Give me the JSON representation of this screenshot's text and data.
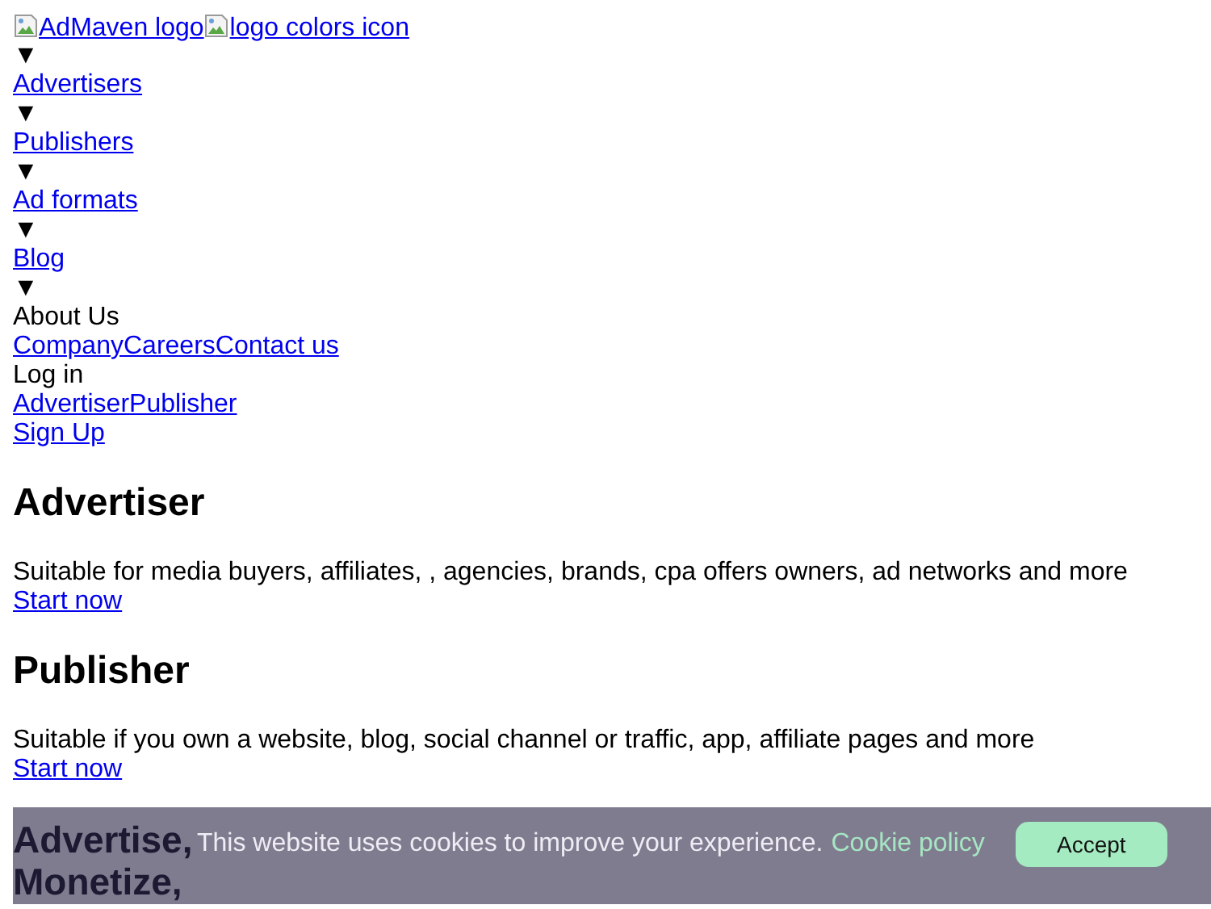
{
  "logos": [
    {
      "alt": "AdMaven logo"
    },
    {
      "alt": "logo colors icon"
    }
  ],
  "nav": [
    {
      "marker": "▼",
      "label": "Advertisers",
      "kind": "link"
    },
    {
      "marker": "▼",
      "label": "Publishers",
      "kind": "link"
    },
    {
      "marker": "▼",
      "label": "Ad formats",
      "kind": "link"
    },
    {
      "marker": "▼",
      "label": "Blog",
      "kind": "link"
    },
    {
      "marker": "▼",
      "label": "About Us",
      "kind": "text"
    }
  ],
  "about_links": [
    "Company",
    "Careers",
    "Contact us"
  ],
  "login": {
    "label": "Log in",
    "links": [
      "Advertiser",
      "Publisher"
    ]
  },
  "signup": "Sign Up",
  "sections": [
    {
      "title": "Advertiser",
      "text": "Suitable for media buyers, affiliates, , agencies, brands, cpa offers owners, ad networks and more",
      "cta": "Start now"
    },
    {
      "title": "Publisher",
      "text": "Suitable if you own a website, blog, social channel or traffic, app, affiliate pages and more",
      "cta": "Start now"
    }
  ],
  "banner": {
    "title_lines": [
      "Advertise,",
      "Monetize,"
    ]
  },
  "cookie": {
    "text": "This website uses cookies to improve your experience.",
    "link": "Cookie policy",
    "button": "Accept"
  }
}
